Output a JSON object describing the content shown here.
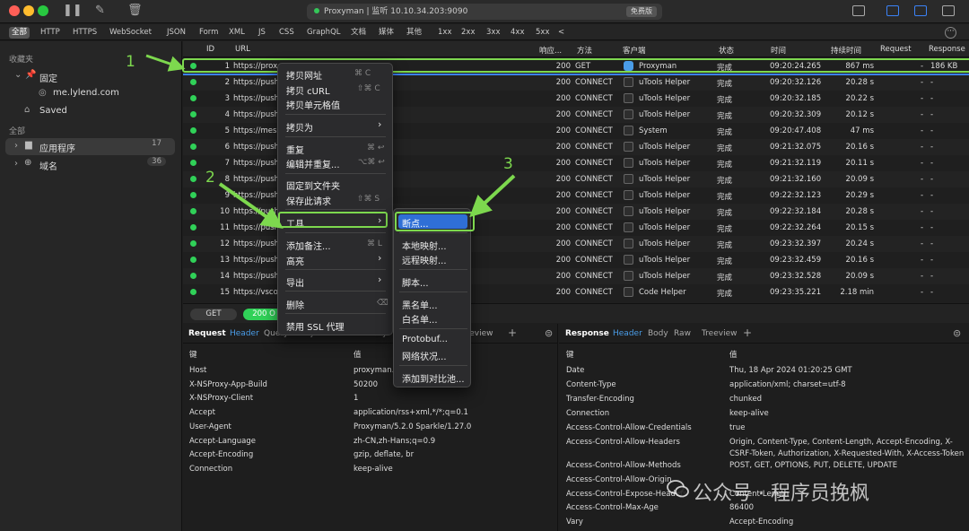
{
  "titlebar": {
    "address": "Proxyman | 监听 10.10.34.203:9090",
    "badge": "免费版"
  },
  "filters": [
    "全部",
    "HTTP",
    "HTTPS",
    "WebSocket",
    "JSON",
    "Form",
    "XML",
    "JS",
    "CSS",
    "GraphQL",
    "文档",
    "媒体",
    "其他",
    "1xx",
    "2xx",
    "3xx",
    "4xx",
    "5xx",
    "<"
  ],
  "sidebar": {
    "favorites_header": "收藏夹",
    "pinned": "固定",
    "pinned_host": "me.lylend.com",
    "saved": "Saved",
    "all_header": "全部",
    "apps": "应用程序",
    "apps_count": "17",
    "domains": "域名",
    "domains_count": "36"
  },
  "columns": [
    "ID",
    "URL",
    "响应...",
    "方法",
    "客户端",
    "状态",
    "时间",
    "持续时间",
    "Request",
    "Response"
  ],
  "rows": [
    [
      "1",
      "https://prox",
      "200",
      "GET",
      "Proxyman",
      "完成",
      "09:20:24.265",
      "867 ms",
      "-",
      "186 KB"
    ],
    [
      "2",
      "https://push",
      "200",
      "CONNECT",
      "uTools Helper",
      "完成",
      "09:20:32.126",
      "20.28 s",
      "-",
      "-"
    ],
    [
      "3",
      "https://push",
      "200",
      "CONNECT",
      "uTools Helper",
      "完成",
      "09:20:32.185",
      "20.22 s",
      "-",
      "-"
    ],
    [
      "4",
      "https://push",
      "200",
      "CONNECT",
      "uTools Helper",
      "完成",
      "09:20:32.309",
      "20.12 s",
      "-",
      "-"
    ],
    [
      "5",
      "https://mesu",
      "200",
      "CONNECT",
      "System",
      "完成",
      "09:20:47.408",
      "47 ms",
      "-",
      "-"
    ],
    [
      "6",
      "https://push",
      "200",
      "CONNECT",
      "uTools Helper",
      "完成",
      "09:21:32.075",
      "20.16 s",
      "-",
      "-"
    ],
    [
      "7",
      "https://push",
      "200",
      "CONNECT",
      "uTools Helper",
      "完成",
      "09:21:32.119",
      "20.11 s",
      "-",
      "-"
    ],
    [
      "8",
      "https://push",
      "200",
      "CONNECT",
      "uTools Helper",
      "完成",
      "09:21:32.160",
      "20.09 s",
      "-",
      "-"
    ],
    [
      "9",
      "https://push",
      "200",
      "CONNECT",
      "uTools Helper",
      "完成",
      "09:22:32.123",
      "20.29 s",
      "-",
      "-"
    ],
    [
      "10",
      "https://push",
      "200",
      "CONNECT",
      "uTools Helper",
      "完成",
      "09:22:32.184",
      "20.28 s",
      "-",
      "-"
    ],
    [
      "11",
      "https://push",
      "200",
      "CONNECT",
      "uTools Helper",
      "完成",
      "09:22:32.264",
      "20.15 s",
      "-",
      "-"
    ],
    [
      "12",
      "https://push",
      "200",
      "CONNECT",
      "uTools Helper",
      "完成",
      "09:23:32.397",
      "20.24 s",
      "-",
      "-"
    ],
    [
      "13",
      "https://push",
      "200",
      "CONNECT",
      "uTools Helper",
      "完成",
      "09:23:32.459",
      "20.16 s",
      "-",
      "-"
    ],
    [
      "14",
      "https://push",
      "200",
      "CONNECT",
      "uTools Helper",
      "完成",
      "09:23:32.528",
      "20.09 s",
      "-",
      "-"
    ],
    [
      "15",
      "https://vsco",
      "200",
      "CONNECT",
      "Code Helper",
      "完成",
      "09:23:35.221",
      "2.18 min",
      "-",
      "-"
    ]
  ],
  "midbar": {
    "method": "GET",
    "status": "200 O"
  },
  "request": {
    "title": "Request",
    "tabs": [
      "Header",
      "Query",
      "Body",
      "Raw",
      "Summary",
      "Treeview"
    ],
    "key_col": "键",
    "val_col": "值",
    "headers": [
      [
        "Host",
        "proxyman.i"
      ],
      [
        "X-NSProxy-App-Build",
        "50200"
      ],
      [
        "X-NSProxy-Client",
        "1"
      ],
      [
        "Accept",
        "application/rss+xml,*/*;q=0.1"
      ],
      [
        "User-Agent",
        "Proxyman/5.2.0 Sparkle/1.27.0"
      ],
      [
        "Accept-Language",
        "zh-CN,zh-Hans;q=0.9"
      ],
      [
        "Accept-Encoding",
        "gzip, deflate, br"
      ],
      [
        "Connection",
        "keep-alive"
      ]
    ]
  },
  "response": {
    "title": "Response",
    "tabs": [
      "Header",
      "Body",
      "Raw",
      "Treeview"
    ],
    "key_col": "键",
    "val_col": "值",
    "headers": [
      [
        "Date",
        "Thu, 18 Apr 2024 01:20:25 GMT"
      ],
      [
        "Content-Type",
        "application/xml; charset=utf-8"
      ],
      [
        "Transfer-Encoding",
        "chunked"
      ],
      [
        "Connection",
        "keep-alive"
      ],
      [
        "Access-Control-Allow-Credentials",
        "true"
      ],
      [
        "Access-Control-Allow-Headers",
        "Origin, Content-Type, Content-Length, Accept-Encoding, X-"
      ],
      [
        "",
        "CSRF-Token, Authorization, X-Requested-With, X-Access-Token"
      ],
      [
        "Access-Control-Allow-Methods",
        "POST, GET, OPTIONS, PUT, DELETE, UPDATE"
      ],
      [
        "Access-Control-Allow-Origin",
        ""
      ],
      [
        "Access-Control-Expose-Headers",
        "Content-Length"
      ],
      [
        "Access-Control-Max-Age",
        "86400"
      ],
      [
        "Vary",
        "Accept-Encoding"
      ]
    ]
  },
  "context_menu": {
    "copy_url": "拷贝网址",
    "copy_url_sc": "⌘ C",
    "copy_curl": "拷贝 cURL",
    "copy_curl_sc": "⇧⌘ C",
    "copy_cell": "拷贝单元格值",
    "copy_as": "拷贝为",
    "repeat": "重复",
    "repeat_sc": "⌘ ↩",
    "edit_repeat": "编辑并重复...",
    "edit_repeat_sc": "⌥⌘ ↩",
    "pin_folder": "固定到文件夹",
    "save_request": "保存此请求",
    "save_request_sc": "⇧⌘ S",
    "tools": "工具",
    "add_note": "添加备注...",
    "add_note_sc": "⌘ L",
    "highlight": "高亮",
    "export": "导出",
    "delete": "删除",
    "delete_sc": "⌫",
    "disable_ssl": "禁用 SSL 代理"
  },
  "tools_menu": {
    "breakpoint": "断点...",
    "map_local": "本地映射...",
    "map_remote": "远程映射...",
    "script": "脚本...",
    "blacklist": "黑名单...",
    "whitelist": "白名单...",
    "protobuf": "Protobuf...",
    "network_conditions": "网络状况...",
    "add_diff": "添加到对比池..."
  },
  "annotations": {
    "n1": "1",
    "n2": "2",
    "n3": "3"
  },
  "watermark": "公众号 · 程序员挽枫",
  "colors": {
    "accent": "#7dd84e",
    "status_ok": "#30d158",
    "selection": "#2f6fd6"
  }
}
